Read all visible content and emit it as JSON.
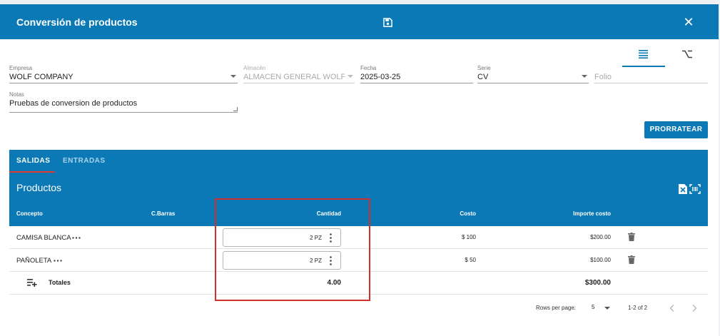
{
  "header": {
    "title": "Conversión de productos",
    "save_icon": "save-icon",
    "close_icon": "close-icon"
  },
  "view_toggles": [
    "list-icon",
    "branch-icon"
  ],
  "form": {
    "empresa": {
      "label": "Empresa",
      "value": "WOLF COMPANY"
    },
    "almacen": {
      "label": "Almacén",
      "value": "ALMACEN GENERAL WOLF C"
    },
    "fecha": {
      "label": "Fecha",
      "value": "2025-03-25"
    },
    "serie": {
      "label": "Serie",
      "value": "CV"
    },
    "folio": {
      "placeholder": "Folio"
    },
    "notas": {
      "label": "Notas",
      "value": "Pruebas de conversion de productos"
    }
  },
  "prorratear_label": "PRORRATEAR",
  "tabs": [
    {
      "label": "SALIDAS",
      "active": true
    },
    {
      "label": "ENTRADAS",
      "active": false
    }
  ],
  "panel": {
    "title": "Productos",
    "columns": {
      "concepto": "Concepto",
      "cbarras": "C.Barras",
      "cantidad": "Cantidad",
      "costo": "Costo",
      "importe": "Importe costo"
    }
  },
  "rows": [
    {
      "concepto": "CAMISA BLANCA",
      "cantidad": "2 PZ",
      "costo": "$ 100",
      "importe": "$200.00"
    },
    {
      "concepto": "PAÑOLETA",
      "cantidad": "2 PZ",
      "costo": "$ 50",
      "importe": "$100.00"
    }
  ],
  "totals": {
    "label": "Totales",
    "cantidad": "4.00",
    "importe": "$300.00"
  },
  "pagination": {
    "rows_label": "Rows per page:",
    "rows_value": "5",
    "range": "1-2 of 2"
  },
  "colors": {
    "primary": "#0a79b5",
    "highlight": "#d32f2f",
    "tab_indicator": "#e53935"
  }
}
